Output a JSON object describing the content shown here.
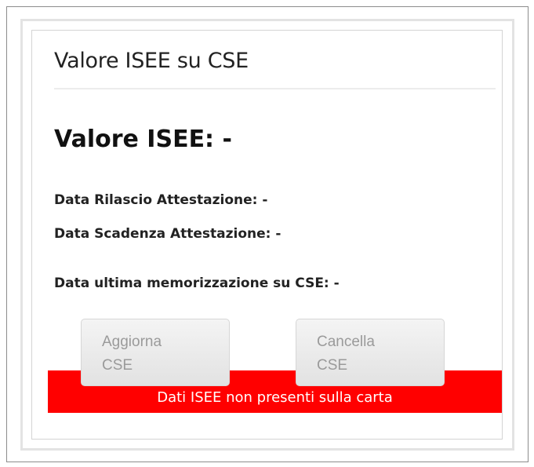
{
  "panel": {
    "title": "Valore ISEE su CSE",
    "isee_value": "Valore ISEE: -",
    "release_date": "Data Rilascio Attestazione: -",
    "expiry_date": "Data Scadenza Attestazione: -",
    "last_stored": "Data ultima memorizzazione su CSE: -"
  },
  "buttons": {
    "update": {
      "line1": "Aggiorna",
      "line2": "CSE"
    },
    "delete": {
      "line1": "Cancella",
      "line2": "CSE"
    }
  },
  "error": {
    "message": "Dati ISEE non presenti sulla carta",
    "color": "#ff0000"
  }
}
